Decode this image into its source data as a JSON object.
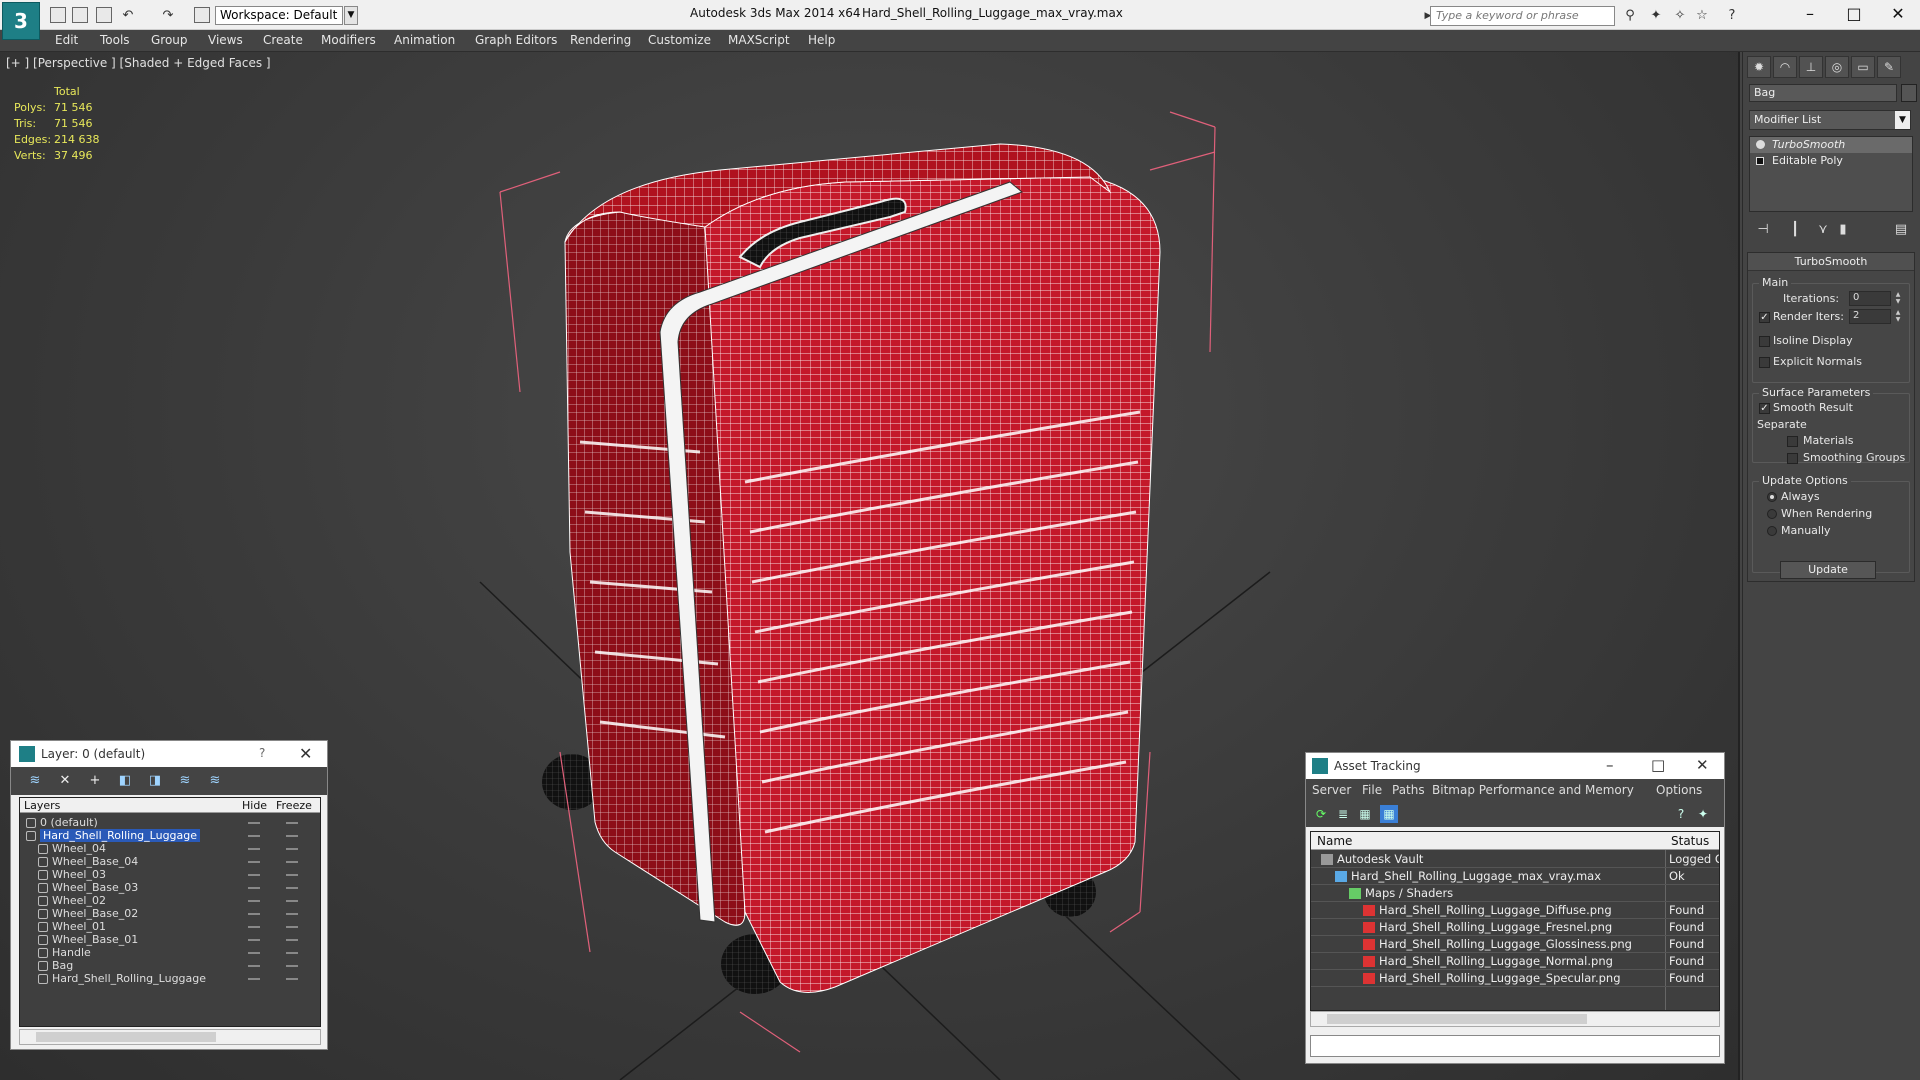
{
  "titlebar": {
    "workspace": "Workspace: Default",
    "app_title": "Autodesk 3ds Max  2014 x64",
    "file_title": "Hard_Shell_Rolling_Luggage_max_vray.max",
    "search_placeholder": "Type a keyword or phrase"
  },
  "menu": [
    "Edit",
    "Tools",
    "Group",
    "Views",
    "Create",
    "Modifiers",
    "Animation",
    "Graph Editors",
    "Rendering",
    "Customize",
    "MAXScript",
    "Help"
  ],
  "viewport": {
    "label": "[+ ] [Perspective ] [Shaded + Edged Faces ]",
    "stats": {
      "header": "Total",
      "rows": [
        {
          "label": "Polys:",
          "value": "71 546"
        },
        {
          "label": "Tris:",
          "value": "71 546"
        },
        {
          "label": "Edges:",
          "value": "214 638"
        },
        {
          "label": "Verts:",
          "value": "37 496"
        }
      ]
    },
    "colors": {
      "bag": "#b0121e",
      "wire": "#ffffff",
      "bbox": "#e0607a",
      "grid": "#1c1c1c"
    }
  },
  "command_panel": {
    "object_name": "Bag",
    "modifier_list": "Modifier List",
    "stack": [
      {
        "label": "TurboSmooth",
        "active": true
      },
      {
        "label": "Editable Poly",
        "active": false
      }
    ],
    "rollout": {
      "title": "TurboSmooth",
      "main_group": "Main",
      "iterations_label": "Iterations:",
      "iterations_value": "0",
      "render_iters_label": "Render Iters:",
      "render_iters_value": "2",
      "isoline": "Isoline Display",
      "explicit_normals": "Explicit Normals",
      "surface_group": "Surface Parameters",
      "smooth_result": "Smooth Result",
      "separate": "Separate",
      "materials": "Materials",
      "smoothing_groups": "Smoothing Groups",
      "update_group": "Update Options",
      "always": "Always",
      "when_rendering": "When Rendering",
      "manually": "Manually",
      "update_button": "Update"
    }
  },
  "layer_window": {
    "title": "Layer: 0 (default)",
    "help": "?",
    "columns": {
      "layers": "Layers",
      "hide": "Hide",
      "freeze": "Freeze"
    },
    "rows": [
      {
        "name": "0 (default)",
        "level": 1,
        "selected": false
      },
      {
        "name": "Hard_Shell_Rolling_Luggage",
        "level": 1,
        "selected": true
      },
      {
        "name": "Wheel_04",
        "level": 2,
        "selected": false
      },
      {
        "name": "Wheel_Base_04",
        "level": 2,
        "selected": false
      },
      {
        "name": "Wheel_03",
        "level": 2,
        "selected": false
      },
      {
        "name": "Wheel_Base_03",
        "level": 2,
        "selected": false
      },
      {
        "name": "Wheel_02",
        "level": 2,
        "selected": false
      },
      {
        "name": "Wheel_Base_02",
        "level": 2,
        "selected": false
      },
      {
        "name": "Wheel_01",
        "level": 2,
        "selected": false
      },
      {
        "name": "Wheel_Base_01",
        "level": 2,
        "selected": false
      },
      {
        "name": "Handle",
        "level": 2,
        "selected": false
      },
      {
        "name": "Bag",
        "level": 2,
        "selected": false
      },
      {
        "name": "Hard_Shell_Rolling_Luggage",
        "level": 2,
        "selected": false
      }
    ]
  },
  "asset_window": {
    "title": "Asset Tracking",
    "menu": [
      "Server",
      "File",
      "Paths",
      "Bitmap Performance and Memory",
      "Options"
    ],
    "columns": {
      "name": "Name",
      "status": "Status"
    },
    "rows": [
      {
        "name": "Autodesk Vault",
        "status": "Logged O",
        "level": 0,
        "icon": "vault-icon"
      },
      {
        "name": "Hard_Shell_Rolling_Luggage_max_vray.max",
        "status": "Ok",
        "level": 1,
        "icon": "max-file-icon"
      },
      {
        "name": "Maps / Shaders",
        "status": "",
        "level": 2,
        "icon": "maps-icon"
      },
      {
        "name": "Hard_Shell_Rolling_Luggage_Diffuse.png",
        "status": "Found",
        "level": 3,
        "icon": "png-icon"
      },
      {
        "name": "Hard_Shell_Rolling_Luggage_Fresnel.png",
        "status": "Found",
        "level": 3,
        "icon": "png-icon"
      },
      {
        "name": "Hard_Shell_Rolling_Luggage_Glossiness.png",
        "status": "Found",
        "level": 3,
        "icon": "png-icon"
      },
      {
        "name": "Hard_Shell_Rolling_Luggage_Normal.png",
        "status": "Found",
        "level": 3,
        "icon": "png-icon"
      },
      {
        "name": "Hard_Shell_Rolling_Luggage_Specular.png",
        "status": "Found",
        "level": 3,
        "icon": "png-icon"
      }
    ]
  }
}
